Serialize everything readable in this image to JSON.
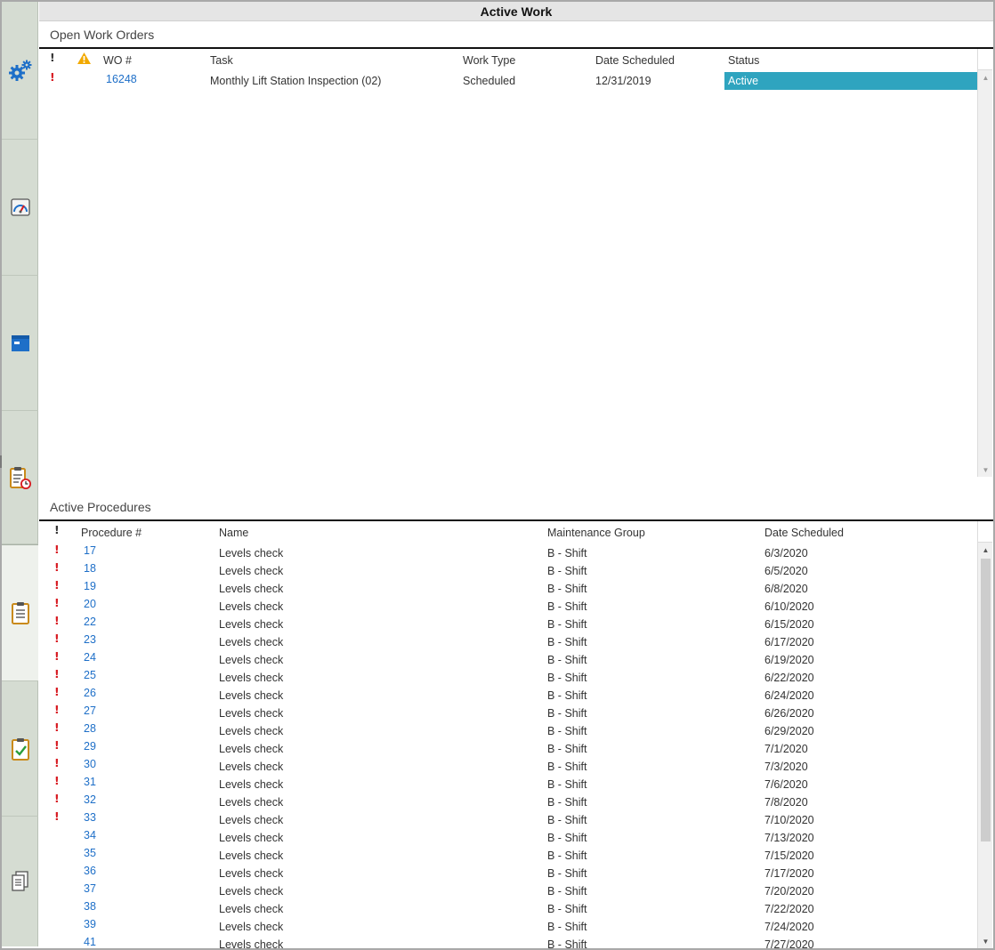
{
  "window": {
    "title": "Active Work"
  },
  "rail": {
    "items": [
      {
        "icon": "gears-icon"
      },
      {
        "icon": "gauge-icon"
      },
      {
        "icon": "window-icon"
      },
      {
        "icon": "clipboard-clock-icon"
      },
      {
        "icon": "clipboard-icon"
      },
      {
        "icon": "clipboard-check-icon"
      },
      {
        "icon": "documents-icon"
      }
    ],
    "selected_index": 4
  },
  "work_orders": {
    "section_title": "Open Work Orders",
    "columns": {
      "priority": "!",
      "warning": "warning-icon",
      "wo": "WO #",
      "task": "Task",
      "work_type": "Work Type",
      "date_scheduled": "Date Scheduled",
      "status": "Status"
    },
    "rows": [
      {
        "priority": "!",
        "wo": "16248",
        "task": "Monthly Lift Station Inspection (02)",
        "work_type": "Scheduled",
        "date_scheduled": "12/31/2019",
        "status": "Active"
      }
    ],
    "status_color": "#2fa4bf"
  },
  "procedures": {
    "section_title": "Active Procedures",
    "columns": {
      "priority": "!",
      "number": "Procedure #",
      "name": "Name",
      "group": "Maintenance Group",
      "date_scheduled": "Date Scheduled"
    },
    "rows": [
      {
        "flag": "!",
        "number": "17",
        "name": "Levels check",
        "group": "B - Shift",
        "date": "6/3/2020"
      },
      {
        "flag": "!",
        "number": "18",
        "name": "Levels check",
        "group": "B - Shift",
        "date": "6/5/2020"
      },
      {
        "flag": "!",
        "number": "19",
        "name": "Levels check",
        "group": "B - Shift",
        "date": "6/8/2020"
      },
      {
        "flag": "!",
        "number": "20",
        "name": "Levels check",
        "group": "B - Shift",
        "date": "6/10/2020"
      },
      {
        "flag": "!",
        "number": "22",
        "name": "Levels check",
        "group": "B - Shift",
        "date": "6/15/2020"
      },
      {
        "flag": "!",
        "number": "23",
        "name": "Levels check",
        "group": "B - Shift",
        "date": "6/17/2020"
      },
      {
        "flag": "!",
        "number": "24",
        "name": "Levels check",
        "group": "B - Shift",
        "date": "6/19/2020"
      },
      {
        "flag": "!",
        "number": "25",
        "name": "Levels check",
        "group": "B - Shift",
        "date": "6/22/2020"
      },
      {
        "flag": "!",
        "number": "26",
        "name": "Levels check",
        "group": "B - Shift",
        "date": "6/24/2020"
      },
      {
        "flag": "!",
        "number": "27",
        "name": "Levels check",
        "group": "B - Shift",
        "date": "6/26/2020"
      },
      {
        "flag": "!",
        "number": "28",
        "name": "Levels check",
        "group": "B - Shift",
        "date": "6/29/2020"
      },
      {
        "flag": "!",
        "number": "29",
        "name": "Levels check",
        "group": "B - Shift",
        "date": "7/1/2020"
      },
      {
        "flag": "!",
        "number": "30",
        "name": "Levels check",
        "group": "B - Shift",
        "date": "7/3/2020"
      },
      {
        "flag": "!",
        "number": "31",
        "name": "Levels check",
        "group": "B - Shift",
        "date": "7/6/2020"
      },
      {
        "flag": "!",
        "number": "32",
        "name": "Levels check",
        "group": "B - Shift",
        "date": "7/8/2020"
      },
      {
        "flag": "!",
        "number": "33",
        "name": "Levels check",
        "group": "B - Shift",
        "date": "7/10/2020"
      },
      {
        "flag": "",
        "number": "34",
        "name": "Levels check",
        "group": "B - Shift",
        "date": "7/13/2020"
      },
      {
        "flag": "",
        "number": "35",
        "name": "Levels check",
        "group": "B - Shift",
        "date": "7/15/2020"
      },
      {
        "flag": "",
        "number": "36",
        "name": "Levels check",
        "group": "B - Shift",
        "date": "7/17/2020"
      },
      {
        "flag": "",
        "number": "37",
        "name": "Levels check",
        "group": "B - Shift",
        "date": "7/20/2020"
      },
      {
        "flag": "",
        "number": "38",
        "name": "Levels check",
        "group": "B - Shift",
        "date": "7/22/2020"
      },
      {
        "flag": "",
        "number": "39",
        "name": "Levels check",
        "group": "B - Shift",
        "date": "7/24/2020"
      },
      {
        "flag": "",
        "number": "41",
        "name": "Levels check",
        "group": "B - Shift",
        "date": "7/27/2020"
      }
    ]
  },
  "colors": {
    "priority": "#d71920",
    "link": "#1e6fc8",
    "warning": "#f2a900",
    "rail": "#d5dcd2"
  }
}
